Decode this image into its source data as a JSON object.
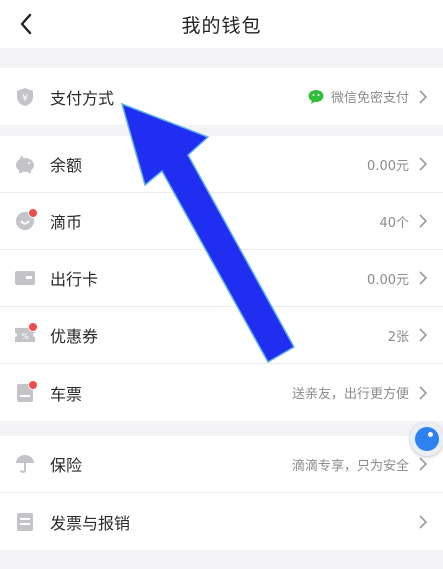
{
  "nav": {
    "title": "我的钱包"
  },
  "payment": {
    "label": "支付方式",
    "value": "微信免密支付"
  },
  "wallet_items": [
    {
      "key": "balance",
      "label": "余额",
      "value": "0.00元"
    },
    {
      "key": "coins",
      "label": "滴币",
      "value": "40个"
    },
    {
      "key": "travel-card",
      "label": "出行卡",
      "value": "0.00元"
    },
    {
      "key": "coupons",
      "label": "优惠券",
      "value": "2张"
    },
    {
      "key": "tickets",
      "label": "车票",
      "value": "送亲友，出行更方便"
    }
  ],
  "services": [
    {
      "key": "insurance",
      "label": "保险",
      "value": "滴滴专享，只为安全"
    },
    {
      "key": "invoice",
      "label": "发票与报销",
      "value": ""
    }
  ],
  "colors": {
    "icon_gray": "#c4c4c8",
    "badge_red": "#f24b4b",
    "wechat_green": "#2fbf3a",
    "arrow_blue": "#1f2ef0",
    "float_blue": "#2d82ef"
  }
}
